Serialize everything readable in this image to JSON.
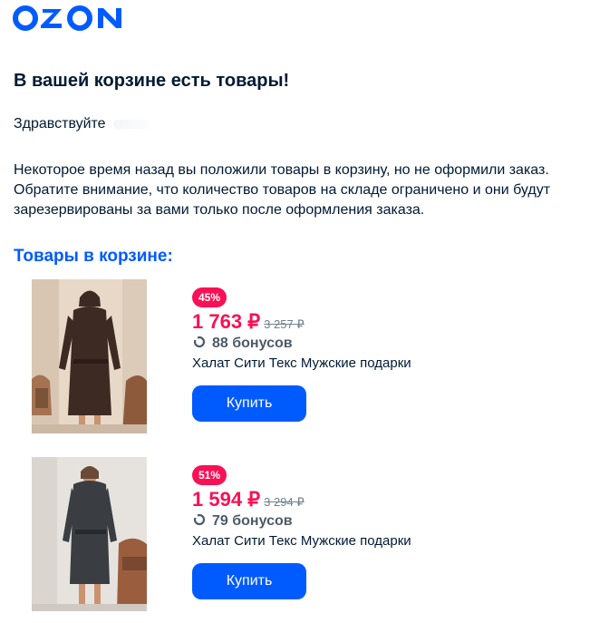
{
  "header": {
    "logo_text": "OZON",
    "brand_color": "#005bff"
  },
  "heading": "В вашей корзине есть товары!",
  "greeting": "Здравствуйте",
  "body_text": "Некоторое время назад вы положили товары в корзину, но не оформили заказ. Обратите внимание, что количество товаров на складе ограничено и они будут зарезервированы за вами только после оформления заказа.",
  "cart_title": "Товары в корзине:",
  "products": [
    {
      "discount": "45%",
      "price": "1 763 ₽",
      "old_price": "3 257 ₽",
      "bonus": "88 бонусов",
      "name": "Халат Сити Текс Мужские подарки",
      "buy_label": "Купить",
      "image_icon": "man-in-bathrobe-photo"
    },
    {
      "discount": "51%",
      "price": "1 594 ₽",
      "old_price": "3 294 ₽",
      "bonus": "79 бонусов",
      "name": "Халат Сити Текс Мужские подарки",
      "buy_label": "Купить",
      "image_icon": "man-in-bathrobe-photo"
    }
  ],
  "colors": {
    "accent": "#005bff",
    "discount": "#f91155",
    "text": "#001a34",
    "muted": "#707f8d"
  }
}
